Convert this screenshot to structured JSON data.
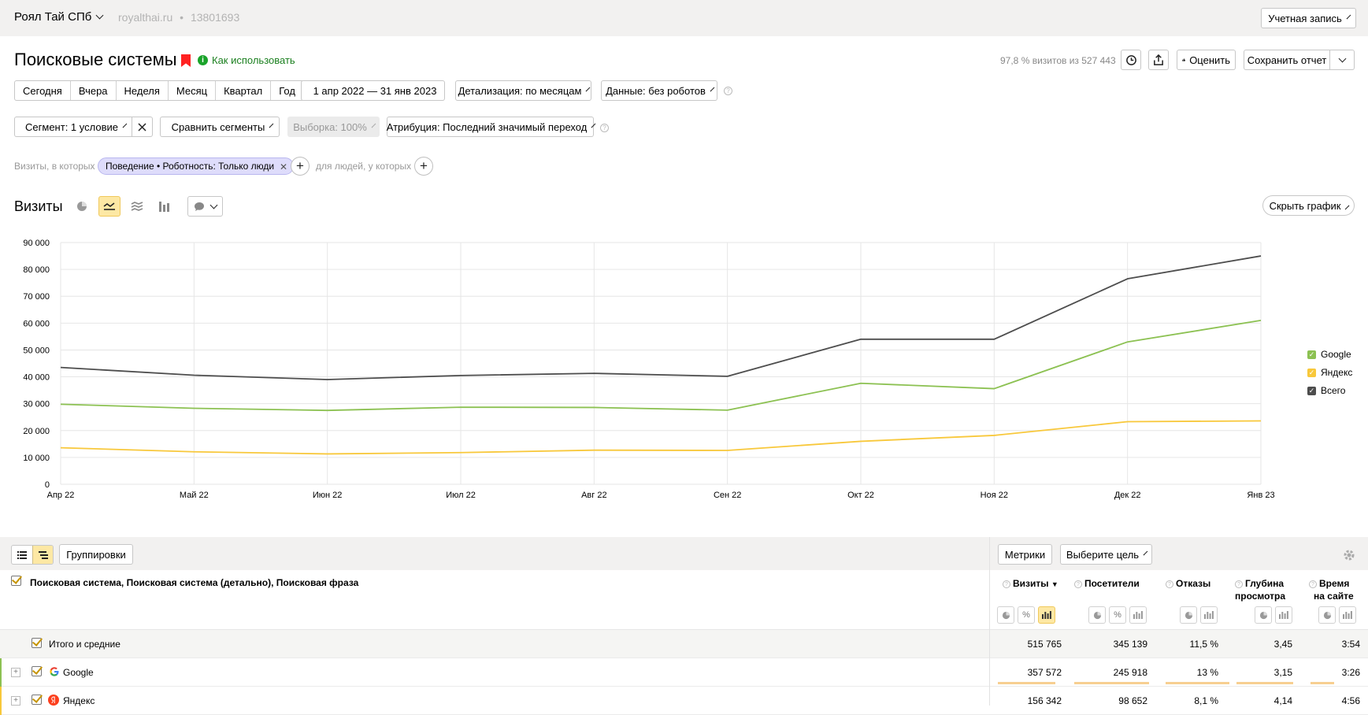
{
  "topbar": {
    "counter_name": "Роял Тай СПб",
    "counter_site": "royalthai.ru",
    "counter_sep": "•",
    "counter_id": "13801693",
    "account_label": "Учетная запись"
  },
  "header": {
    "title": "Поисковые системы",
    "howto_label": "Как использовать",
    "visits_share": "97,8 % визитов из 527 443",
    "rate_label": "Оценить",
    "save_report_label": "Сохранить отчет"
  },
  "periods": [
    "Сегодня",
    "Вчера",
    "Неделя",
    "Месяц",
    "Квартал",
    "Год"
  ],
  "date_range": "1 апр 2022 — 31 янв 2023",
  "detail_label": "Детализация: по месяцам",
  "data_label": "Данные: без роботов",
  "segment_label": "Сегмент: 1 условие",
  "compare_label": "Сравнить сегменты",
  "sample_label": "Выборка: 100%",
  "attribution_label": "Атрибуция: Последний значимый переход",
  "filter": {
    "visits_prefix": "Визиты, в которых",
    "chip_label": "Поведение • Роботность: Только люди",
    "people_prefix": "для людей, у которых"
  },
  "chart_section": {
    "title": "Визиты",
    "hide_label": "Скрыть график"
  },
  "chart_data": {
    "type": "line",
    "categories": [
      "Апр 22",
      "Май 22",
      "Июн 22",
      "Июл 22",
      "Авг 22",
      "Сен 22",
      "Окт 22",
      "Ноя 22",
      "Дек 22",
      "Янв 23"
    ],
    "ylim": [
      0,
      90000
    ],
    "yticks": [
      "0",
      "10 000",
      "20 000",
      "30 000",
      "40 000",
      "50 000",
      "60 000",
      "70 000",
      "80 000",
      "90 000"
    ],
    "grid": true,
    "legend_position": "right",
    "series": [
      {
        "name": "Google",
        "color": "#8cc152",
        "values": [
          29800,
          28300,
          27500,
          28700,
          28600,
          27600,
          37600,
          35600,
          53000,
          61000
        ]
      },
      {
        "name": "Яндекс",
        "color": "#f8c83b",
        "values": [
          13600,
          12100,
          11300,
          11800,
          12700,
          12600,
          16000,
          18200,
          23300,
          23600
        ]
      },
      {
        "name": "Всего",
        "color": "#4d4d4d",
        "values": [
          43500,
          40600,
          39000,
          40500,
          41300,
          40200,
          54000,
          54000,
          76500,
          85000
        ]
      }
    ]
  },
  "table": {
    "groupings_label": "Группировки",
    "metrics_label": "Метрики",
    "goal_label": "Выберите цель",
    "dimension_title": "Поисковая система, Поисковая система (детально), Поисковая фраза",
    "metrics": [
      {
        "l1": "Визиты",
        "l2": "",
        "sort": "▼"
      },
      {
        "l1": "Посетители",
        "l2": "",
        "sort": ""
      },
      {
        "l1": "Отказы",
        "l2": "",
        "sort": ""
      },
      {
        "l1": "Глубина",
        "l2": "просмотра",
        "sort": ""
      },
      {
        "l1": "Время",
        "l2": "на сайте",
        "sort": ""
      }
    ],
    "rows": [
      {
        "label": "Итого и средние",
        "visits": "515 765",
        "users": "345 139",
        "bounce": "11,5 %",
        "depth": "3,45",
        "time": "3:54"
      },
      {
        "label": "Google",
        "visits": "357 572",
        "users": "245 918",
        "bounce": "13 %",
        "depth": "3,15",
        "time": "3:26"
      },
      {
        "label": "Яндекс",
        "visits": "156 342",
        "users": "98 652",
        "bounce": "8,1 %",
        "depth": "4,14",
        "time": "4:56"
      }
    ]
  }
}
